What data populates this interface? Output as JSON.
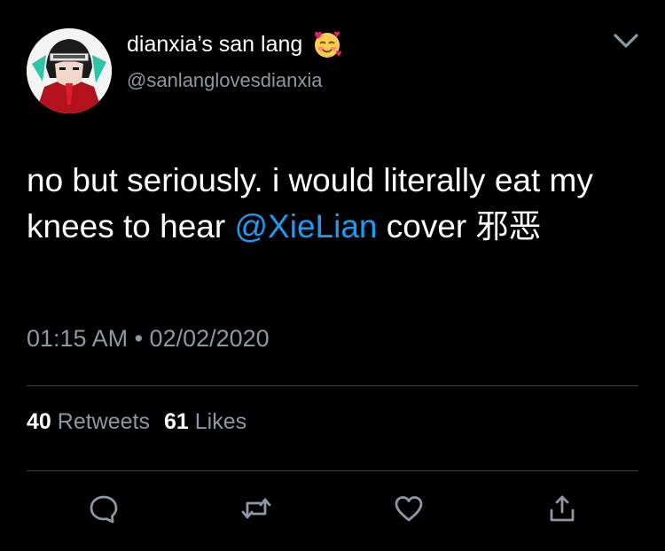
{
  "author": {
    "display_name": "dianxia’s san lang",
    "emoji": "smiling-face-with-hearts",
    "handle": "@sanlanglovesdianxia"
  },
  "tweet": {
    "text_before": "no but seriously. i would literally eat my knees to hear ",
    "mention": "@XieLian",
    "text_after": " cover 邪恶",
    "time": "01:15 AM",
    "separator": " • ",
    "date": "02/02/2020"
  },
  "stats": {
    "retweets_count": "40",
    "retweets_label": "Retweets",
    "likes_count": "61",
    "likes_label": "Likes"
  },
  "actions": [
    "reply-icon",
    "retweet-icon",
    "like-icon",
    "share-icon"
  ],
  "colors": {
    "background": "#000000",
    "text": "#ffffff",
    "secondary": "#8b98a5",
    "mention": "#1d9bf0",
    "divider": "#38444d"
  }
}
